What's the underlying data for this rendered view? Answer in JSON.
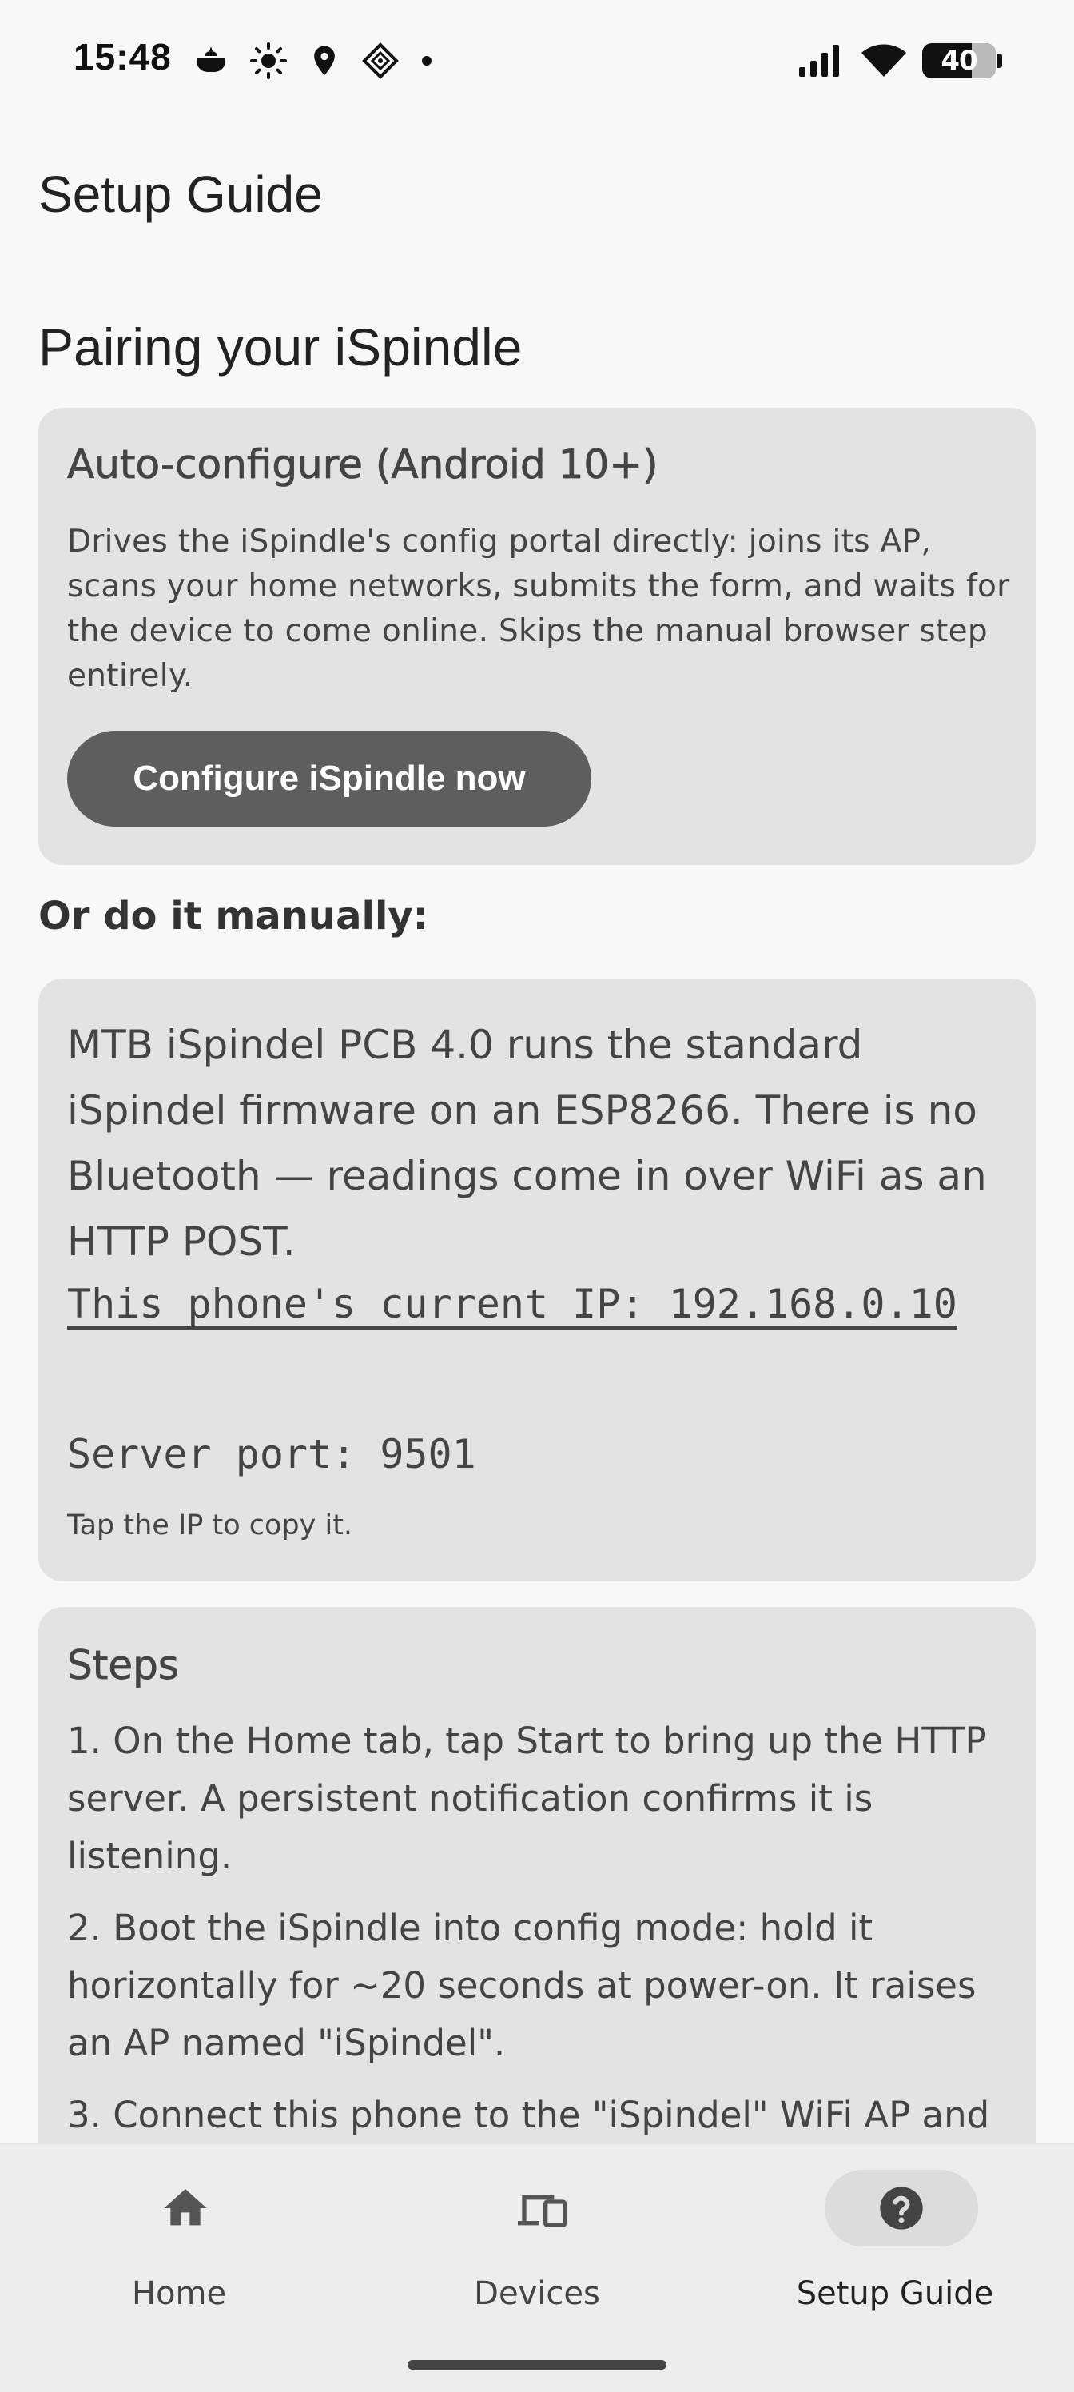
{
  "status_bar": {
    "time": "15:48",
    "left_icons": [
      "pot-icon",
      "brightness-icon",
      "location-icon",
      "app-diamond-icon",
      "dot-icon"
    ],
    "right_icons": [
      "signal-icon",
      "wifi-icon"
    ],
    "battery_level": "40"
  },
  "header": {
    "title": "Setup Guide"
  },
  "main": {
    "section_title": "Pairing your iSpindle",
    "auto_card": {
      "title": "Auto-configure (Android 10+)",
      "description": "Drives the iSpindle's config portal directly: joins its AP, scans your home networks, submits the form, and waits for the device to come online. Skips the manual browser step entirely.",
      "button_label": "Configure iSpindle now"
    },
    "manual_heading": "Or do it manually:",
    "manual_card": {
      "description": "MTB iSpindel PCB 4.0 runs the standard iSpindel firmware on an ESP8266. There is no Bluetooth — readings come in over WiFi as an HTTP POST.",
      "ip_text": "This phone's current IP: 192.168.0.10",
      "port_text": "Server port: 9501",
      "hint": "Tap the IP to copy it."
    },
    "steps_card": {
      "title": "Steps",
      "items": [
        "1. On the Home tab, tap Start to bring up the HTTP server. A persistent notification confirms it is listening.",
        "2. Boot the iSpindle into config mode: hold it horizontally for ~20 seconds at power-on. It raises an AP named \"iSpindel\".",
        "3. Connect this phone to the \"iSpindel\" WiFi AP and"
      ]
    }
  },
  "bottom_nav": {
    "items": [
      {
        "label": "Home",
        "icon": "home-icon"
      },
      {
        "label": "Devices",
        "icon": "devices-icon"
      },
      {
        "label": "Setup Guide",
        "icon": "help-icon",
        "selected": true
      }
    ]
  }
}
